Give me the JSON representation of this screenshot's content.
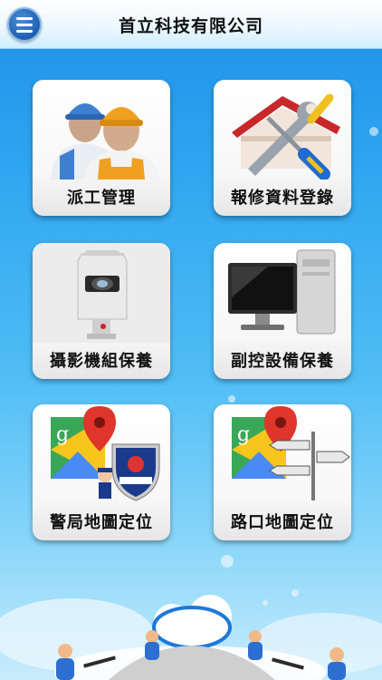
{
  "header": {
    "title": "首立科技有限公司",
    "menu_icon": "hamburger-menu-icon"
  },
  "tiles": [
    {
      "label": "派工管理",
      "icon": "workers-icon"
    },
    {
      "label": "報修資料登錄",
      "icon": "repair-tools-icon"
    },
    {
      "label": "攝影機組保養",
      "icon": "security-camera-icon"
    },
    {
      "label": "副控設備保養",
      "icon": "computer-equipment-icon"
    },
    {
      "label": "警局地圖定位",
      "icon": "police-map-icon"
    },
    {
      "label": "路口地圖定位",
      "icon": "intersection-map-icon"
    }
  ],
  "colors": {
    "header_bg": "#eaf7ff",
    "background_top": "#1e90e8",
    "background_bottom": "#c8ecfc",
    "menu_button": "#1f5fb0"
  }
}
